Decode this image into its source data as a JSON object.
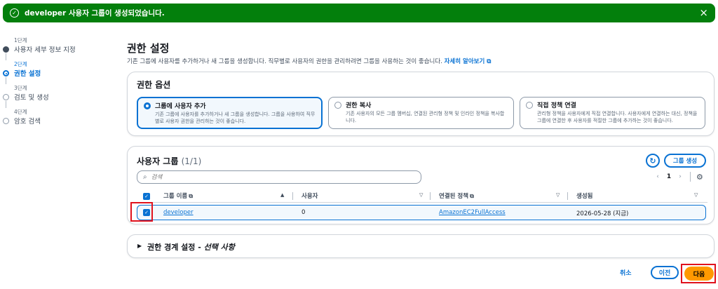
{
  "flash": {
    "message": "developer 사용자 그룹이 생성되었습니다.",
    "close_icon": "×",
    "success_icon": "✓"
  },
  "steps": [
    {
      "num": "1단계",
      "label": "사용자 세부 정보 지정",
      "state": "done"
    },
    {
      "num": "2단계",
      "label": "권한 설정",
      "state": "active"
    },
    {
      "num": "3단계",
      "label": "검토 및 생성",
      "state": "todo"
    },
    {
      "num": "4단계",
      "label": "암호 검색",
      "state": "todo"
    }
  ],
  "page": {
    "title": "권한 설정",
    "description": "기존 그룹에 사용자를 추가하거나 새 그룹을 생성합니다. 직무별로 사용자의 권한을 관리하려면 그룹을 사용하는 것이 좋습니다.",
    "learn_more": "자세히 알아보기",
    "external_icon": "⧉"
  },
  "options": {
    "heading": "권한 옵션",
    "items": [
      {
        "title": "그룹에 사용자 추가",
        "desc": "기존 그룹에 사용자를 추가하거나 새 그룹을 생성합니다. 그룹을 사용하여 직무별로 사용자 권한을 관리하는 것이 좋습니다.",
        "selected": true
      },
      {
        "title": "권한 복사",
        "desc": "기존 사용자의 모든 그룹 멤버십, 연결된 관리형 정책 및 인라인 정책을 복사합니다.",
        "selected": false
      },
      {
        "title": "직접 정책 연결",
        "desc": "관리형 정책을 사용자에게 직접 연결합니다. 사용자에게 연결하는 대신, 정책을 그룹에 연결한 후 사용자를 적절한 그룹에 추가하는 것이 좋습니다.",
        "selected": false
      }
    ]
  },
  "groups": {
    "heading": "사용자 그룹",
    "count": "(1/1)",
    "refresh_icon": "↻",
    "create_label": "그룹 생성",
    "search_placeholder": "검색",
    "search_icon": "⌕",
    "page_prev_icon": "‹",
    "page_next_icon": "›",
    "page_number": "1",
    "settings_icon": "⚙",
    "columns": {
      "name": "그룹 이름",
      "users": "사용자",
      "policies": "연결된 정책",
      "created": "생성됨"
    },
    "sort_asc_icon": "▲",
    "sort_icon": "▽",
    "check_icon": "✓",
    "rows": [
      {
        "name": "developer",
        "users": "0",
        "policy": "AmazonEC2FullAccess",
        "created": "2026-05-28 (지금)",
        "checked": true
      }
    ]
  },
  "boundary": {
    "toggle_icon": "▶",
    "title": "권한 경계 설정 - ",
    "optional": "선택 사항"
  },
  "footer": {
    "cancel": "취소",
    "previous": "이전",
    "next": "다음"
  },
  "colors": {
    "success": "#037f0c",
    "accent": "#0972d3",
    "primary": "#ff9900",
    "highlight": "#e0121d"
  }
}
